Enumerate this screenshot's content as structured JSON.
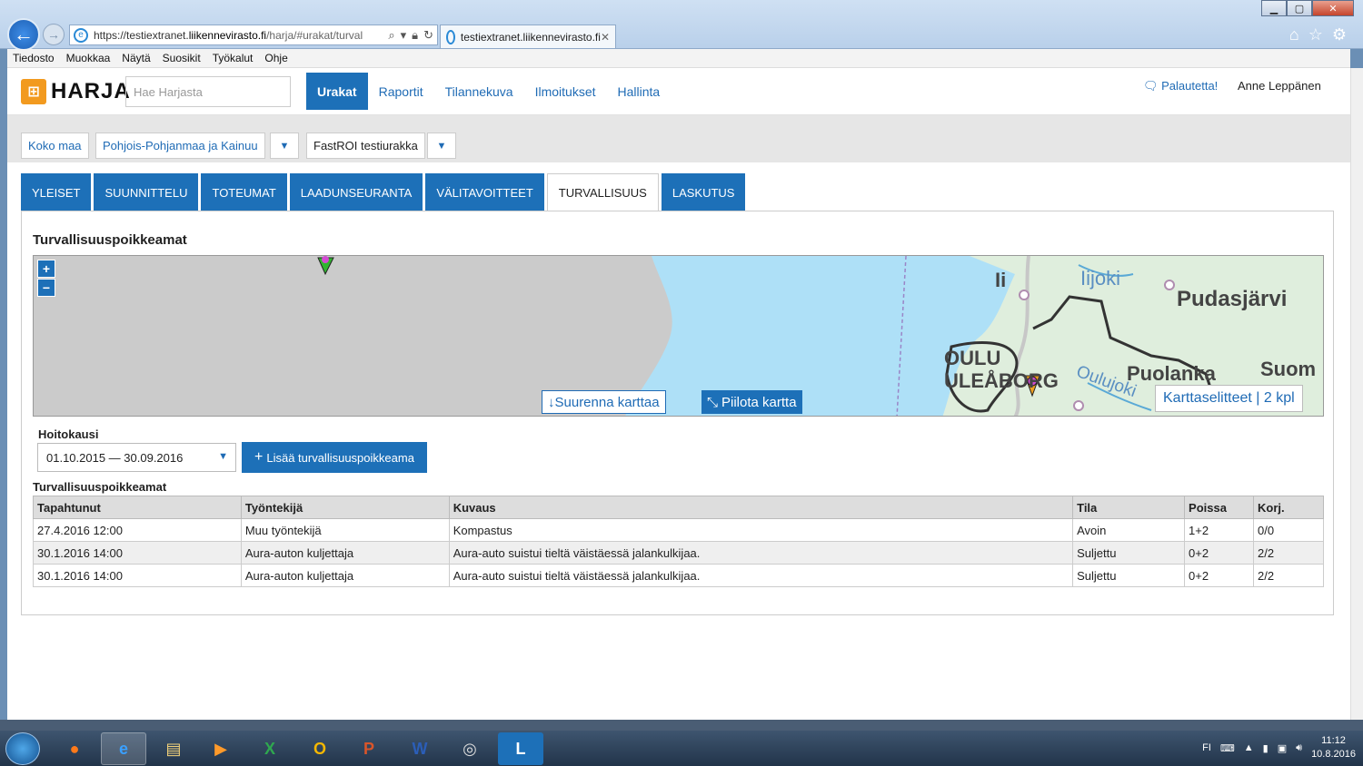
{
  "browser": {
    "url_prefix": "https://testiextranet.",
    "url_domain": "liikennevirasto.fi",
    "url_path": "/harja/#urakat/turval",
    "tab_title": "testiextranet.liikennevirasto.fi",
    "menu": [
      "Tiedosto",
      "Muokkaa",
      "Näytä",
      "Suosikit",
      "Työkalut",
      "Ohje"
    ]
  },
  "header": {
    "logo_text": "HARJA",
    "search_placeholder": "Hae Harjasta",
    "nav": [
      "Urakat",
      "Raportit",
      "Tilannekuva",
      "Ilmoitukset",
      "Hallinta"
    ],
    "nav_active": "Urakat",
    "feedback": "Palautetta!",
    "user": "Anne Leppänen"
  },
  "breadcrumb": {
    "root": "Koko maa",
    "region": "Pohjois-Pohjanmaa ja Kainuu",
    "contract": "FastROI testiurakka"
  },
  "tabs": [
    "YLEISET",
    "SUUNNITTELU",
    "TOTEUMAT",
    "LAADUNSEURANTA",
    "VÄLITAVOITTEET",
    "TURVALLISUUS",
    "LASKUTUS"
  ],
  "active_tab": "TURVALLISUUS",
  "section": {
    "title": "Turvallisuuspoikkeamat",
    "map": {
      "zoom_in": "+",
      "zoom_out": "−",
      "enlarge": "Suurenna karttaa",
      "hide": "Piilota kartta",
      "legend": "Karttaselitteet | 2 kpl",
      "labels": [
        "Ii",
        "Iijoki",
        "Pudasjärvi",
        "OULU",
        "ULEÅBORG",
        "Oulujoki",
        "Puolanka",
        "Suom"
      ]
    },
    "period_label": "Hoitokausi",
    "period_value": "01.10.2015 — 30.09.2016",
    "add_button": "Lisää turvallisuuspoikkeama",
    "table_title": "Turvallisuuspoikkeamat",
    "columns": [
      "Tapahtunut",
      "Työntekijä",
      "Kuvaus",
      "Tila",
      "Poissa",
      "Korj."
    ],
    "rows": [
      [
        "27.4.2016 12:00",
        "Muu työntekijä",
        "Kompastus",
        "Avoin",
        "1+2",
        "0/0"
      ],
      [
        "30.1.2016 14:00",
        "Aura-auton kuljettaja",
        "Aura-auto suistui tieltä väistäessä jalankulkijaa.",
        "Suljettu",
        "0+2",
        "2/2"
      ],
      [
        "30.1.2016 14:00",
        "Aura-auton kuljettaja",
        "Aura-auto suistui tieltä väistäessä jalankulkijaa.",
        "Suljettu",
        "0+2",
        "2/2"
      ]
    ]
  },
  "taskbar": {
    "apps": [
      "Firefox",
      "Internet Explorer",
      "Explorer",
      "Media",
      "Excel",
      "Outlook",
      "PowerPoint",
      "Word",
      "Settings",
      "Lync"
    ],
    "lang": "FI",
    "time": "11:12",
    "date": "10.8.2016"
  },
  "colors": {
    "brand_blue": "#1d70b8",
    "logo_orange": "#f29a1f",
    "map_sea": "#aee0f7",
    "map_land": "#dfeedd"
  }
}
